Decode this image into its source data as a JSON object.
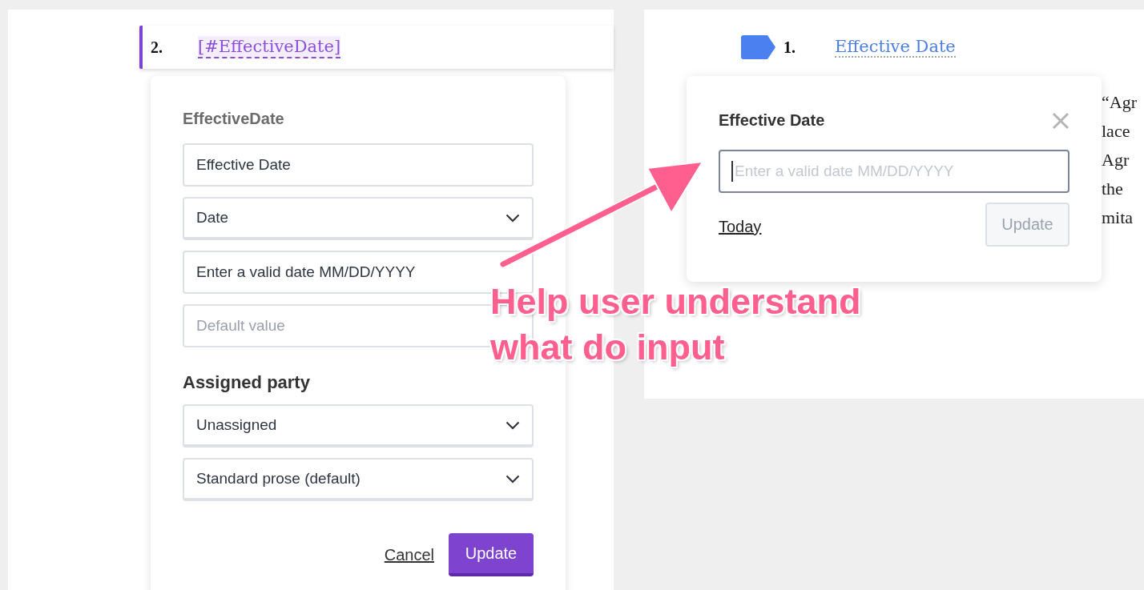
{
  "left_document": {
    "clause_number": "2.",
    "field_tag": "[#EffectiveDate]"
  },
  "field_editor": {
    "title": "EffectiveDate",
    "fields": [
      {
        "kind": "text",
        "value": "Effective Date"
      },
      {
        "kind": "select",
        "value": "Date"
      },
      {
        "kind": "text",
        "value": "Enter a valid date MM/DD/YYYY"
      },
      {
        "kind": "text",
        "placeholder": "Default value"
      }
    ],
    "section_title": "Assigned party",
    "party_fields": [
      {
        "kind": "select",
        "value": "Unassigned"
      },
      {
        "kind": "select",
        "value": "Standard prose (default)"
      }
    ],
    "buttons": [
      {
        "label": "Cancel",
        "kind": "link"
      },
      {
        "label": "Update",
        "kind": "primary"
      }
    ]
  },
  "right_document": {
    "clause_number": "1.",
    "field_link": "Effective Date",
    "text_fragments": [
      "“Agr",
      "lace",
      "Agr",
      "the",
      "mita"
    ]
  },
  "date_popover": {
    "title": "Effective Date",
    "input": {
      "placeholder": "Enter a valid date MM/DD/YYYY"
    },
    "link": "Today",
    "button": {
      "label": "Update",
      "disabled": true
    }
  },
  "annotation": {
    "lines": [
      "Help user understand",
      "what do input"
    ]
  }
}
